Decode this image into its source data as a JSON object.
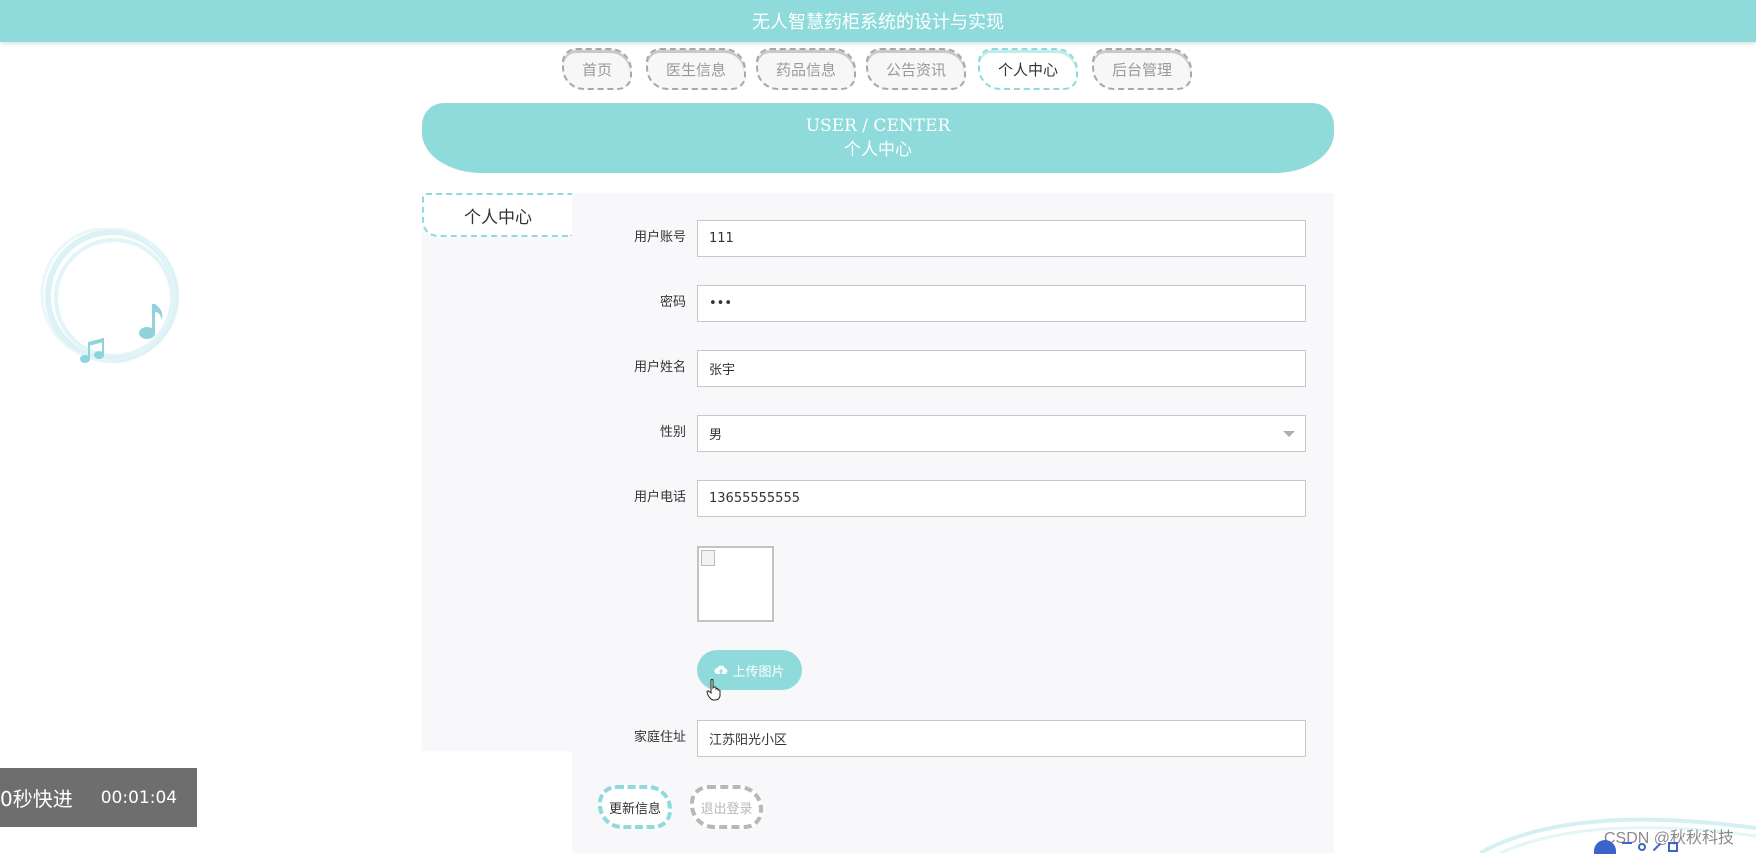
{
  "app": {
    "title": "无人智慧药柜系统的设计与实现"
  },
  "nav": {
    "tabs": [
      {
        "label": "首页",
        "active": false
      },
      {
        "label": "医生信息",
        "active": false
      },
      {
        "label": "药品信息",
        "active": false
      },
      {
        "label": "公告资讯",
        "active": false
      },
      {
        "label": "个人中心",
        "active": true
      },
      {
        "label": "后台管理",
        "active": false
      }
    ]
  },
  "banner": {
    "en": "USER / CENTER",
    "cn": "个人中心"
  },
  "sidebar": {
    "items": [
      {
        "label": "个人中心"
      }
    ]
  },
  "form": {
    "account_label": "用户账号",
    "account_value": "111",
    "password_label": "密码",
    "password_value": "•••",
    "name_label": "用户姓名",
    "name_value": "张宇",
    "gender_label": "性别",
    "gender_value": "男",
    "phone_label": "用户电话",
    "phone_value": "13655555555",
    "upload_label": "上传图片",
    "address_label": "家庭住址",
    "address_value": "江苏阳光小区",
    "update_label": "更新信息",
    "logout_label": "退出登录"
  },
  "overlay": {
    "speed_text": "0秒快进",
    "time_text": "00:01:04"
  },
  "watermark": {
    "text": "CSDN @秋秋科技"
  },
  "colors": {
    "accent": "#8fdbdb",
    "panel_bg": "#f8f8fa",
    "inactive_border": "#a8a8a8"
  },
  "icons": {
    "upload": "cloud-upload-icon",
    "gender_dropdown": "chevron-down-icon",
    "cursor": "hand-pointer-icon",
    "decoration": "music-note-icon"
  }
}
